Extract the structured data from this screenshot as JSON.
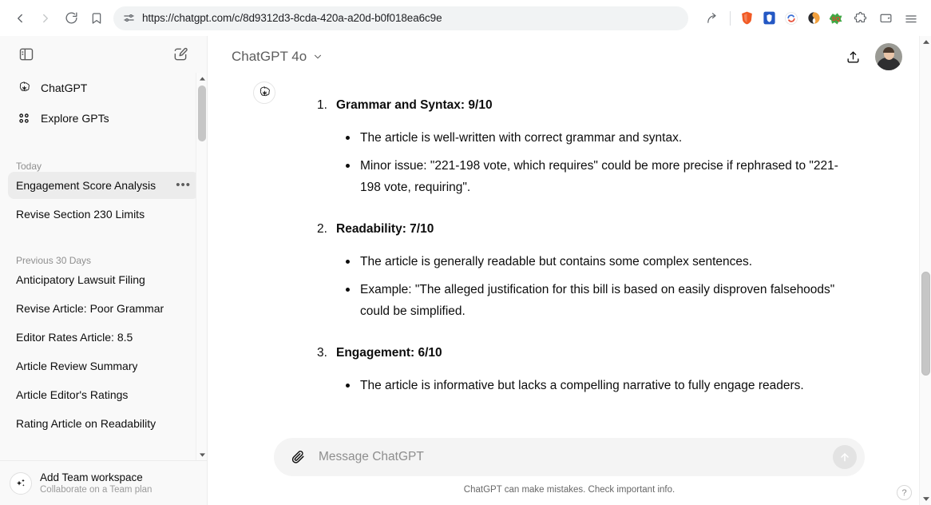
{
  "browser": {
    "url": "https://chatgpt.com/c/8d9312d3-8cda-420a-a20d-b0f018ea6c9e",
    "back_label": "Back",
    "forward_label": "Forward",
    "reload_label": "Reload",
    "bookmark_label": "Bookmark this page",
    "site_settings_label": "site-settings-icon",
    "share_label": "Share this page",
    "brave_label": "Brave Shields",
    "extensions": [
      {
        "name": "1password-extension",
        "glyph": "U",
        "color": "#2458c4"
      },
      {
        "name": "sync-extension",
        "glyph": "",
        "color": "#e8503a"
      },
      {
        "name": "grammar-extension",
        "glyph": "",
        "color": "#f2a03d"
      },
      {
        "name": "sq-extension",
        "glyph": "SQ",
        "color": "#3fa845"
      }
    ],
    "puzzle_label": "Extensions",
    "wallet_label": "Brave Wallet",
    "menu_label": "Customize and control Brave"
  },
  "sidebar": {
    "toggle_label": "Close sidebar",
    "new_chat_label": "New chat",
    "nav": [
      {
        "icon": "openai-logo-icon",
        "label": "ChatGPT"
      },
      {
        "icon": "grid-icon",
        "label": "Explore GPTs"
      }
    ],
    "sections": [
      {
        "title": "Today",
        "chats": [
          {
            "title": "Engagement Score Analysis",
            "active": true,
            "options_label": "•••"
          },
          {
            "title": "Revise Section 230 Limits",
            "active": false
          }
        ]
      },
      {
        "title": "Previous 30 Days",
        "chats": [
          {
            "title": "Anticipatory Lawsuit Filing",
            "active": false
          },
          {
            "title": "Revise Article: Poor Grammar",
            "active": false
          },
          {
            "title": "Editor Rates Article: 8.5",
            "active": false
          },
          {
            "title": "Article Review Summary",
            "active": false
          },
          {
            "title": "Article Editor's Ratings",
            "active": false
          },
          {
            "title": "Rating Article on Readability",
            "active": false
          }
        ]
      }
    ],
    "workspace": {
      "title": "Add Team workspace",
      "subtitle": "Collaborate on a Team plan",
      "icon": "sparkles-icon"
    }
  },
  "header": {
    "model": "ChatGPT 4o",
    "model_chevron": "chevron-down-icon",
    "share_label": "Share chat",
    "avatar_label": "User account"
  },
  "conversation": {
    "assistant_icon": "openai-logo-icon",
    "items": [
      {
        "heading": "Grammar and Syntax: 9/10",
        "bullets": [
          "The article is well-written with correct grammar and syntax.",
          "Minor issue: \"221-198 vote, which requires\" could be more precise if rephrased to \"221-198 vote, requiring\"."
        ]
      },
      {
        "heading": "Readability: 7/10",
        "bullets": [
          "The article is generally readable but contains some complex sentences.",
          "Example: \"The alleged justification for this bill is based on easily disproven falsehoods\" could be simplified."
        ]
      },
      {
        "heading": "Engagement: 6/10",
        "bullets": [
          "The article is informative but lacks a compelling narrative to fully engage readers."
        ]
      }
    ],
    "scroll_down_label": "Scroll to bottom"
  },
  "composer": {
    "attach_label": "Attach file",
    "placeholder": "Message ChatGPT",
    "value": "",
    "send_label": "Send message"
  },
  "footer": {
    "disclaimer": "ChatGPT can make mistakes. Check important info.",
    "help_label": "?"
  }
}
